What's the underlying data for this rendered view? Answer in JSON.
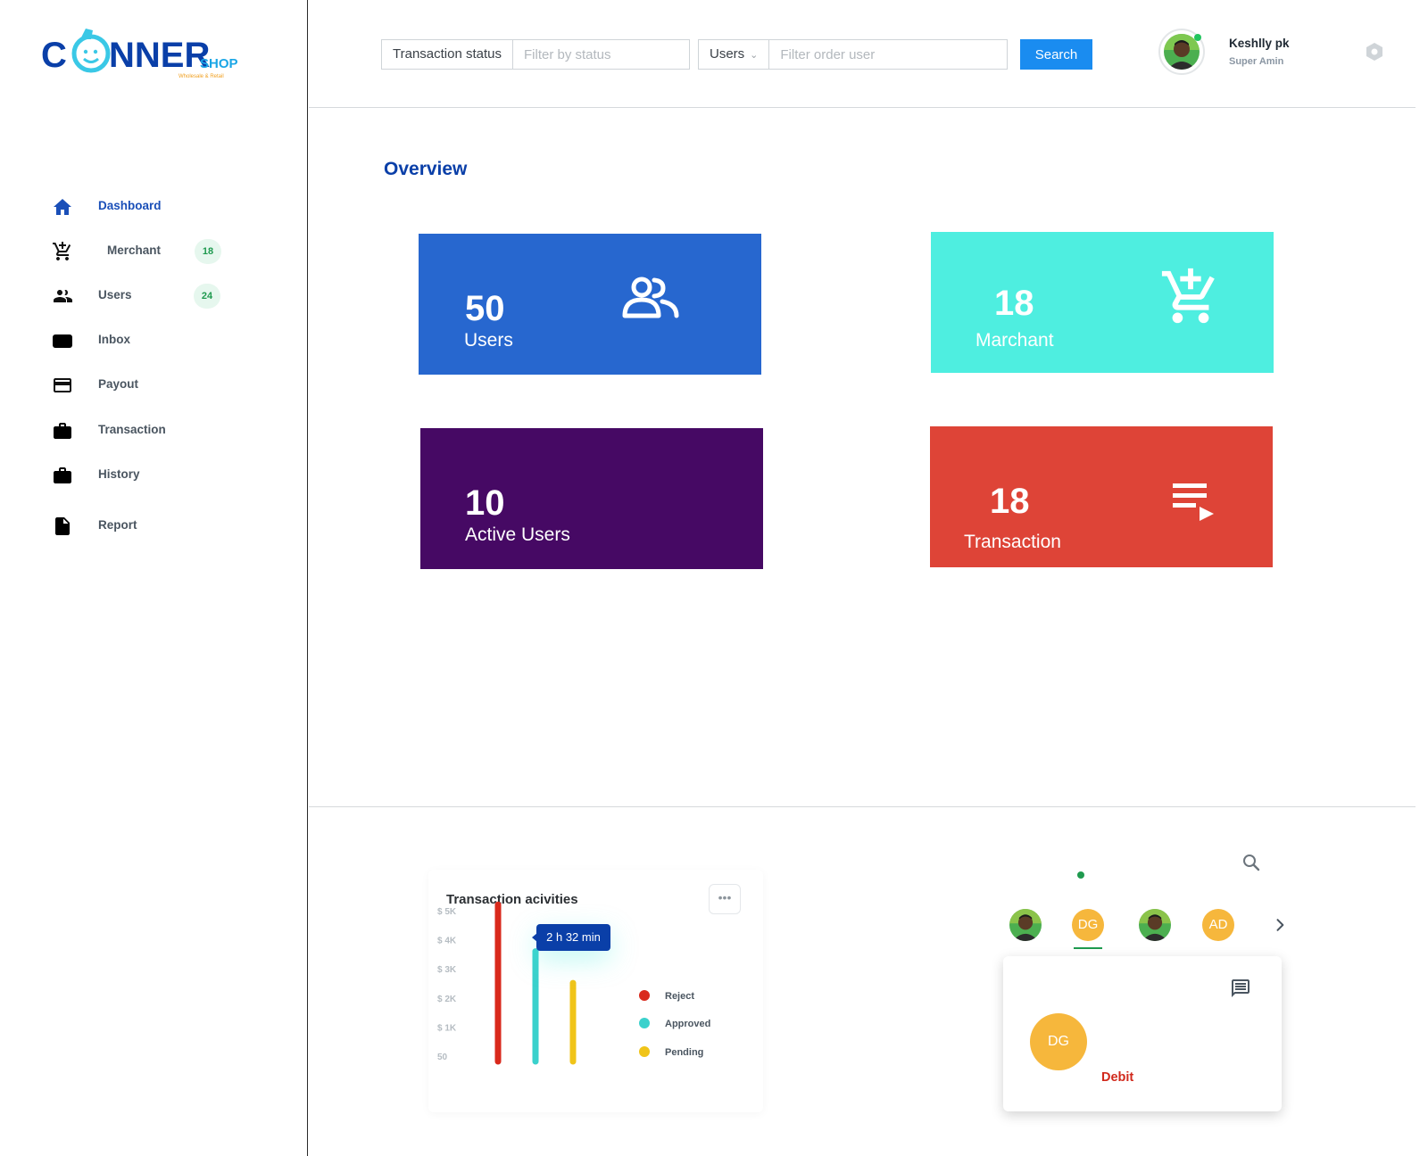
{
  "brand": {
    "logo_main": "C   NNER",
    "logo_sub": "SHOP",
    "logo_tagline": "Wholesale & Retail"
  },
  "sidebar": {
    "items": [
      {
        "label": "Dashboard",
        "icon": "home-icon",
        "active": true
      },
      {
        "label": "Merchant",
        "icon": "cart-plus-icon",
        "badge": "18"
      },
      {
        "label": "Users",
        "icon": "users-icon",
        "badge": "24"
      },
      {
        "label": "Inbox",
        "icon": "inbox-icon"
      },
      {
        "label": "Payout",
        "icon": "credit-card-icon"
      },
      {
        "label": "Transaction",
        "icon": "briefcase-icon"
      },
      {
        "label": "History",
        "icon": "briefcase-icon"
      },
      {
        "label": "Report",
        "icon": "document-icon"
      }
    ]
  },
  "header": {
    "status_filter_label": "Transaction status",
    "status_filter_placeholder": "Filter by status",
    "user_filter_label": "Users",
    "user_filter_placeholder": "Filter order user",
    "search_label": "Search",
    "user_name": "Keshlly pk",
    "user_role": "Super Amin"
  },
  "overview": {
    "title": "Overview",
    "cards": [
      {
        "value": "50",
        "label": "Users",
        "color": "#2767cf",
        "icon": "users-icon"
      },
      {
        "value": "18",
        "label": "Marchant",
        "color": "#4eeee0",
        "icon": "cart-plus-icon"
      },
      {
        "value": "10",
        "label": "Active Users",
        "color": "#460964"
      },
      {
        "value": "18",
        "label": "Transaction",
        "color": "#de4437",
        "icon": "playlist-play-icon"
      }
    ]
  },
  "activity": {
    "title": "Transaction acivities",
    "more_label": "•••",
    "tooltip": "2 h 32 min"
  },
  "chart_data": {
    "type": "bar",
    "title": "Transaction acivities",
    "y_ticks": [
      "$ 5K",
      "$ 4K",
      "$ 3K",
      "$ 2K",
      "$ 1K",
      "50"
    ],
    "ylim": [
      0,
      5000
    ],
    "grid": false,
    "legend_position": "right",
    "series": [
      {
        "name": "Reject",
        "color": "#d9291c",
        "value": 5200
      },
      {
        "name": "Approved",
        "color": "#3ad1cc",
        "value": 3650
      },
      {
        "name": "Pending",
        "color": "#f0c419",
        "value": 2600
      }
    ]
  },
  "contacts": {
    "items": [
      {
        "type": "photo"
      },
      {
        "type": "initials",
        "initials": "DG",
        "selected": true
      },
      {
        "type": "photo"
      },
      {
        "type": "initials",
        "initials": "AD"
      }
    ],
    "detail": {
      "initials": "DG",
      "type": "Debit"
    }
  }
}
